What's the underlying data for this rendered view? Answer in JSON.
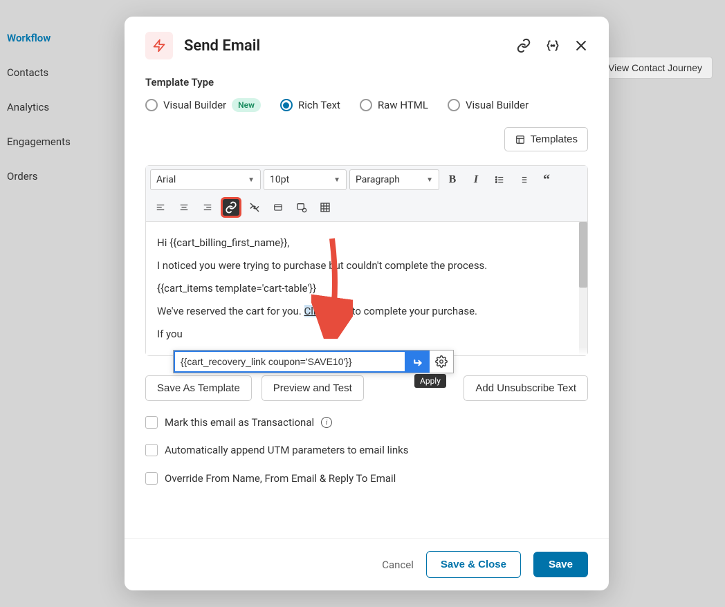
{
  "sidebar": {
    "items": [
      {
        "label": "Workflow",
        "active": true
      },
      {
        "label": "Contacts",
        "active": false
      },
      {
        "label": "Analytics",
        "active": false
      },
      {
        "label": "Engagements",
        "active": false
      },
      {
        "label": "Orders",
        "active": false
      }
    ]
  },
  "view_journey_label": "View Contact Journey",
  "modal": {
    "title": "Send Email",
    "template_type_label": "Template Type",
    "radios": {
      "visual_new": "Visual Builder",
      "new_badge": "New",
      "rich_text": "Rich Text",
      "raw_html": "Raw HTML",
      "visual": "Visual Builder"
    },
    "templates_btn": "Templates",
    "toolbar": {
      "font": "Arial",
      "size": "10pt",
      "block": "Paragraph"
    },
    "editor": {
      "line1_pre": "Hi ",
      "line1_var": "{{cart_billing_first_name}},",
      "line2": "I noticed you were trying to purchase but couldn't complete the process.",
      "line3": "{{cart_items template='cart-table'}}",
      "line4_pre": "We've reserved the cart for you. ",
      "line4_link": "Click here",
      "line4_post": " to complete your purchase.",
      "line5_pre": "If you"
    },
    "link_popup": {
      "value": "{{cart_recovery_link coupon='SAVE10'}}",
      "tooltip": "Apply"
    },
    "save_as_template": "Save As Template",
    "preview_test": "Preview and Test",
    "add_unsub": "Add Unsubscribe Text",
    "check_transactional": "Mark this email as Transactional",
    "check_utm": "Automatically append UTM parameters to email links",
    "check_override": "Override From Name, From Email & Reply To Email",
    "footer": {
      "cancel": "Cancel",
      "save_close": "Save & Close",
      "save": "Save"
    }
  }
}
